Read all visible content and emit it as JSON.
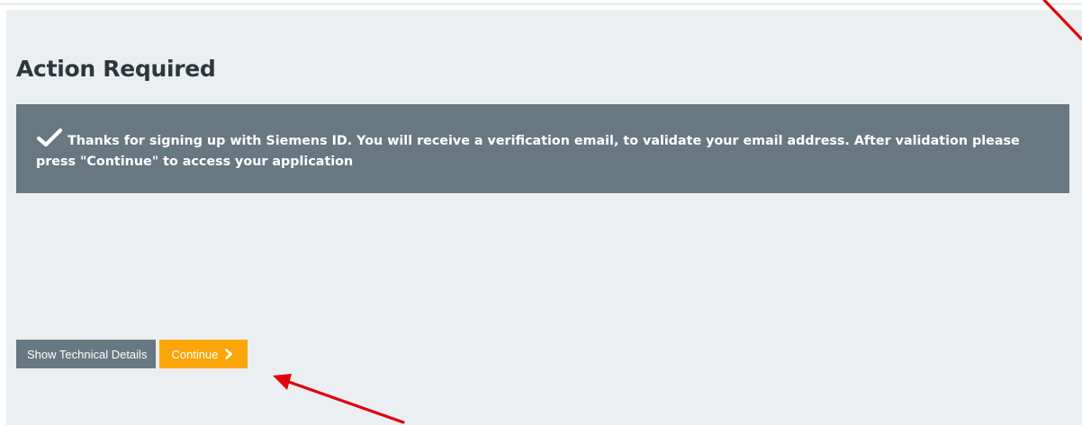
{
  "page": {
    "title": "Action Required"
  },
  "alert": {
    "icon": "checkmark-icon",
    "message": "Thanks for signing up with Siemens ID. You will receive a verification email, to validate your email address. After validation please press \"Continue\" to access your application"
  },
  "actions": {
    "technical_details_label": "Show Technical Details",
    "continue_label": "Continue",
    "continue_icon": "chevron-right-icon"
  },
  "colors": {
    "background": "#ebeff2",
    "title": "#2d373c",
    "alert_bg": "#687882",
    "secondary_button": "#687882",
    "primary_button": "#faa50a",
    "annotation_arrow": "#e0000a"
  }
}
